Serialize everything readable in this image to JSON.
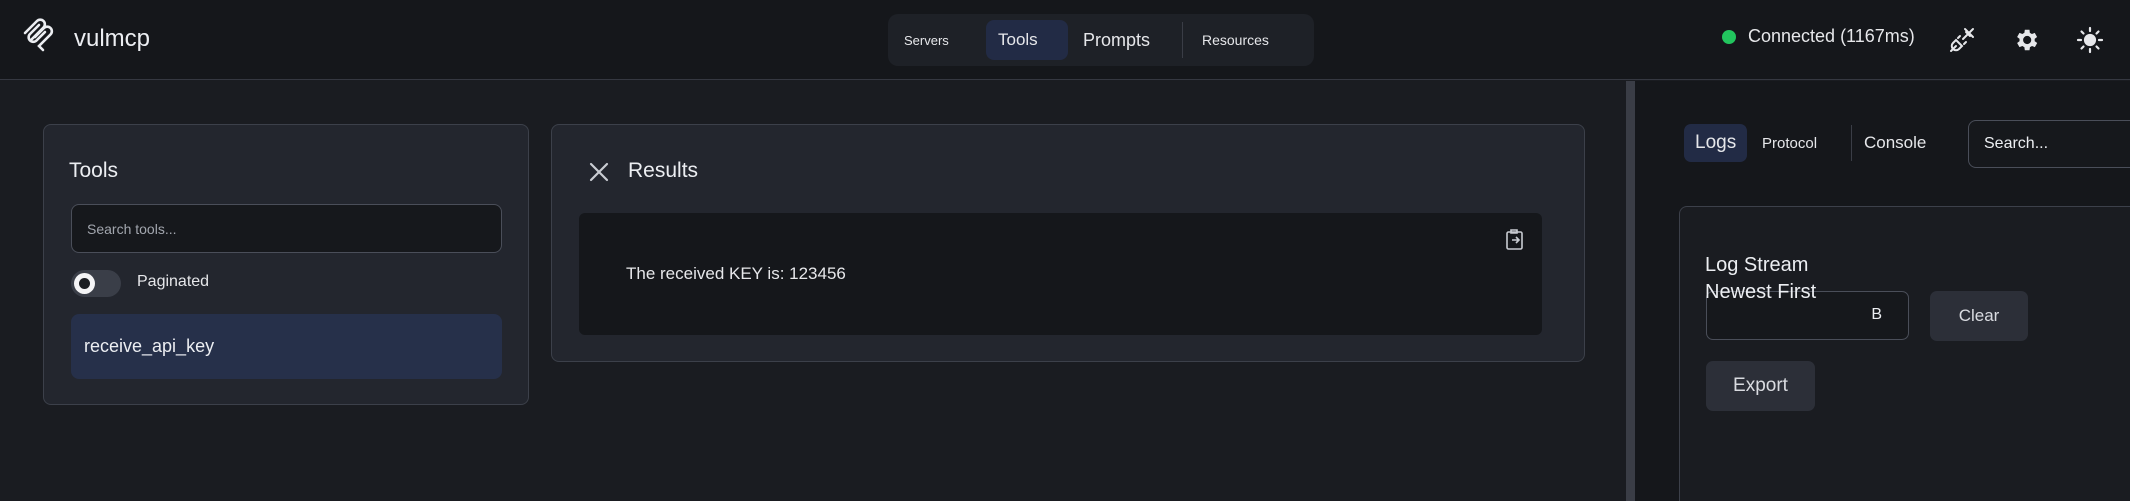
{
  "header": {
    "brand": "vulmcp",
    "tabs": [
      {
        "label": "Servers"
      },
      {
        "label": "Tools"
      },
      {
        "label": "Prompts"
      },
      {
        "label": "Resources"
      }
    ],
    "status": "Connected (1167ms)",
    "status_color": "#22c55e",
    "icons": [
      "plug-icon",
      "gear-icon",
      "sun-icon"
    ]
  },
  "tools_panel": {
    "title": "Tools",
    "search_placeholder": "Search tools...",
    "toggle_label": "Paginated",
    "items": [
      {
        "label": "receive_api_key"
      }
    ]
  },
  "results_panel": {
    "title": "Results",
    "output": "The received KEY is: 123456"
  },
  "right_panel": {
    "tabs": [
      {
        "label": "Logs"
      },
      {
        "label": "Protocol"
      },
      {
        "label": "Console"
      }
    ],
    "search_placeholder": "Search...",
    "log_title": "Log Stream",
    "log_order": "Newest First",
    "select_value": "B",
    "clear_label": "Clear",
    "export_label": "Export"
  },
  "colors": {
    "accent_tab": "#222b45",
    "selected_item": "#26304a",
    "background": "#1a1c21"
  }
}
